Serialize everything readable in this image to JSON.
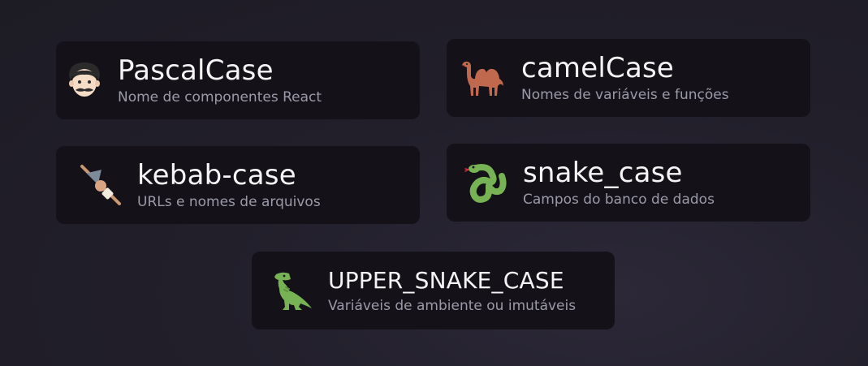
{
  "cards": [
    {
      "icon": "man-with-mustache-icon",
      "title": "PascalCase",
      "subtitle": "Nome de componentes React"
    },
    {
      "icon": "camel-icon",
      "title": "camelCase",
      "subtitle": "Nomes de variáveis e funções"
    },
    {
      "icon": "oden-skewer-icon",
      "title": "kebab-case",
      "subtitle": "URLs e nomes de arquivos"
    },
    {
      "icon": "snake-icon",
      "title": "snake_case",
      "subtitle": "Campos do banco de dados"
    },
    {
      "icon": "t-rex-icon",
      "title": "UPPER_SNAKE_CASE",
      "subtitle": "Variáveis de ambiente ou imutáveis"
    }
  ]
}
